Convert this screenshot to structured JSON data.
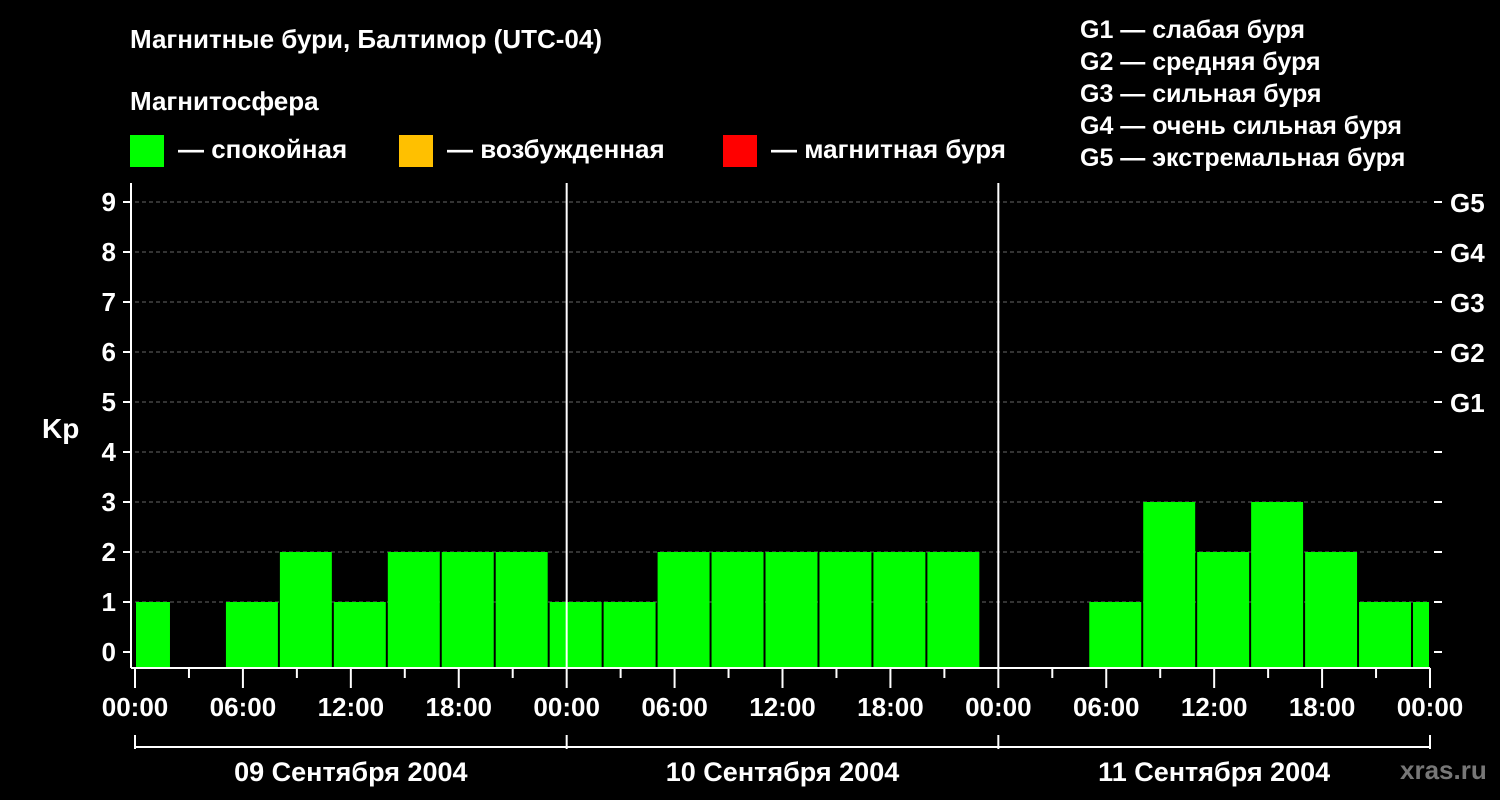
{
  "title": "Магнитные бури, Балтимор (UTC-04)",
  "subtitle": "Магнитосфера",
  "legend": [
    {
      "label": "— спокойная",
      "color": "#00ff00"
    },
    {
      "label": "— возбужденная",
      "color": "#ffc000"
    },
    {
      "label": "— магнитная буря",
      "color": "#ff0000"
    }
  ],
  "g_scale": [
    "G1 — слабая буря",
    "G2 — средняя буря",
    "G3 — сильная буря",
    "G4 — очень сильная буря",
    "G5 — экстремальная буря"
  ],
  "watermark": "xras.ru",
  "chart_data": {
    "type": "bar",
    "ylabel": "Kp",
    "ylim": [
      0,
      9
    ],
    "yticks": [
      0,
      1,
      2,
      3,
      4,
      5,
      6,
      7,
      8,
      9
    ],
    "right_ticks": [
      {
        "value": 5,
        "label": "G1"
      },
      {
        "value": 6,
        "label": "G2"
      },
      {
        "value": 7,
        "label": "G3"
      },
      {
        "value": 8,
        "label": "G4"
      },
      {
        "value": 9,
        "label": "G5"
      }
    ],
    "xticks": [
      "00:00",
      "06:00",
      "12:00",
      "18:00",
      "00:00",
      "06:00",
      "12:00",
      "18:00",
      "00:00",
      "06:00",
      "12:00",
      "18:00",
      "00:00"
    ],
    "days": [
      "09 Сентября 2004",
      "10 Сентября 2004",
      "11 Сентября 2004"
    ],
    "bars": [
      {
        "start": "09 00:00",
        "end": "09 02:00",
        "kp": 1
      },
      {
        "start": "09 02:00",
        "end": "09 05:00",
        "kp": 0
      },
      {
        "start": "09 05:00",
        "end": "09 08:00",
        "kp": 1
      },
      {
        "start": "09 08:00",
        "end": "09 11:00",
        "kp": 2
      },
      {
        "start": "09 11:00",
        "end": "09 14:00",
        "kp": 1
      },
      {
        "start": "09 14:00",
        "end": "09 17:00",
        "kp": 2
      },
      {
        "start": "09 17:00",
        "end": "09 20:00",
        "kp": 2
      },
      {
        "start": "09 20:00",
        "end": "09 23:00",
        "kp": 2
      },
      {
        "start": "09 23:00",
        "end": "10 02:00",
        "kp": 1
      },
      {
        "start": "10 02:00",
        "end": "10 05:00",
        "kp": 1
      },
      {
        "start": "10 05:00",
        "end": "10 08:00",
        "kp": 2
      },
      {
        "start": "10 08:00",
        "end": "10 11:00",
        "kp": 2
      },
      {
        "start": "10 11:00",
        "end": "10 14:00",
        "kp": 2
      },
      {
        "start": "10 14:00",
        "end": "10 17:00",
        "kp": 2
      },
      {
        "start": "10 17:00",
        "end": "10 20:00",
        "kp": 2
      },
      {
        "start": "10 20:00",
        "end": "10 23:00",
        "kp": 2
      },
      {
        "start": "10 23:00",
        "end": "11 02:00",
        "kp": 0
      },
      {
        "start": "11 02:00",
        "end": "11 05:00",
        "kp": 0
      },
      {
        "start": "11 05:00",
        "end": "11 08:00",
        "kp": 1
      },
      {
        "start": "11 08:00",
        "end": "11 11:00",
        "kp": 3
      },
      {
        "start": "11 11:00",
        "end": "11 14:00",
        "kp": 2
      },
      {
        "start": "11 14:00",
        "end": "11 17:00",
        "kp": 3
      },
      {
        "start": "11 17:00",
        "end": "11 20:00",
        "kp": 2
      },
      {
        "start": "11 20:00",
        "end": "11 23:00",
        "kp": 1
      },
      {
        "start": "11 23:00",
        "end": "12 00:00",
        "kp": 1
      }
    ],
    "grid": "dashed horizontal"
  }
}
